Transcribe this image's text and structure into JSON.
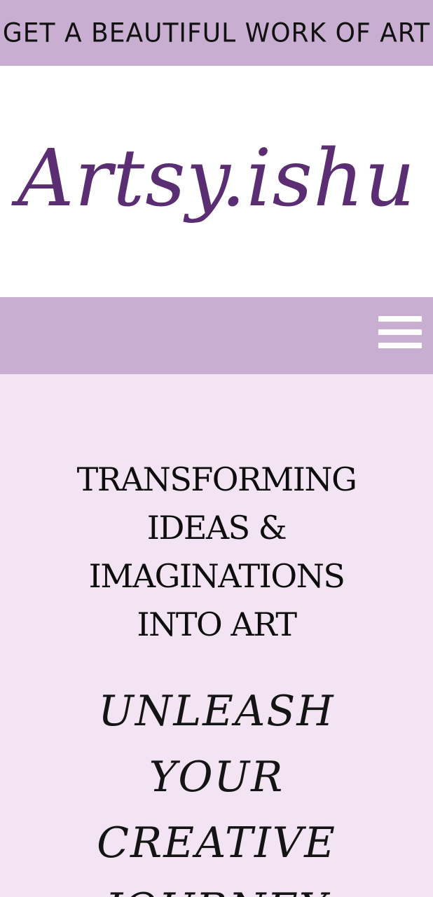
{
  "announcement": {
    "text": "GET A BEAUTIFUL WORK OF ART"
  },
  "brand": {
    "logo_text": "Artsy.ishu",
    "logo_color": "#5b2e73"
  },
  "nav": {
    "menu_icon": "hamburger-menu-icon"
  },
  "hero": {
    "heading": "TRANSFORMING IDEAS & IMAGINATIONS INTO ART",
    "subheading": "UNLEASH YOUR CREATIVE JOURNEY"
  },
  "colors": {
    "bar_background": "#c8aed0",
    "hero_background": "#f2e4f3",
    "logo_background": "#ffffff"
  }
}
